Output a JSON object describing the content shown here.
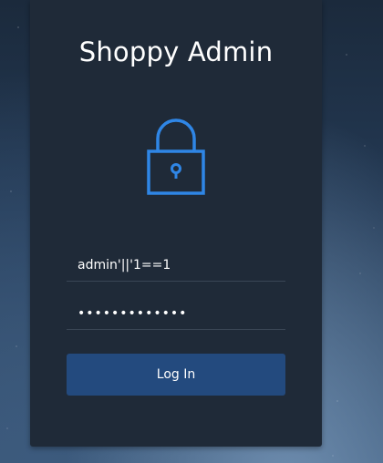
{
  "app": {
    "title": "Shoppy Admin"
  },
  "lock_icon": {
    "name": "lock-icon",
    "color": "#2f86e6"
  },
  "login_form": {
    "username_value": "admin'||'1==1",
    "password_value": "passwordpass!"
  },
  "login_button": {
    "label": "Log In",
    "color": "#234a7e"
  }
}
